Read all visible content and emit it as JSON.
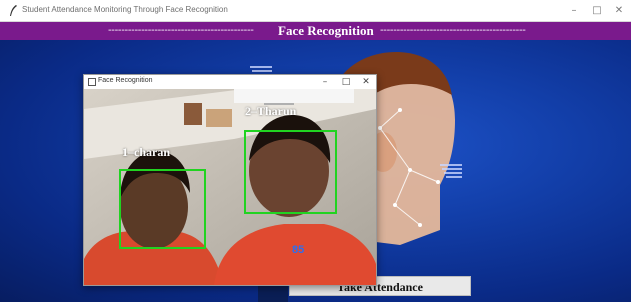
{
  "window": {
    "title": "Student Attendance Monitoring Through Face Recognition",
    "controls": {
      "minimize": "–",
      "maximize": "□",
      "close": "✕"
    }
  },
  "banner": {
    "dashes_left": "--------------------------------------------",
    "heading": "Face Recognition",
    "dashes_right": "--------------------------------------------"
  },
  "camera_window": {
    "title": "Face Recognition",
    "controls": {
      "minimize": "–",
      "maximize": "□",
      "close": "✕"
    },
    "faces": [
      {
        "label": "1–charan"
      },
      {
        "label": "2–Tharun"
      }
    ],
    "confidence": "85"
  },
  "buttons": {
    "take_attendance": "Take Attendance"
  },
  "colors": {
    "banner": "#7a1a8c",
    "background": "#0d2a85",
    "face_box": "#21d321",
    "confidence_text": "#2a6ff2"
  },
  "icons": [
    "app-feather-icon",
    "camera-window-icon"
  ]
}
